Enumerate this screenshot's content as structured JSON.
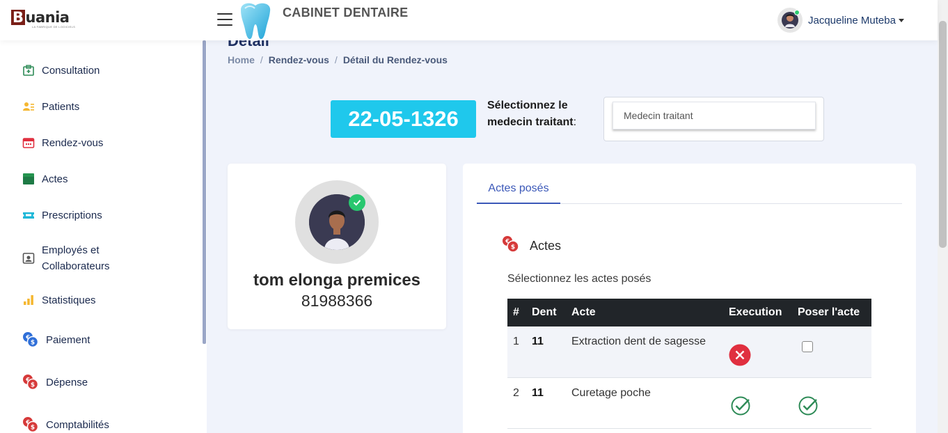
{
  "header": {
    "logo_text": "uania",
    "logo_initial": "B",
    "logo_tagline": "LA FABRIQUE DE LOGICIELS",
    "brand_title": "CABINET DENTAIRE",
    "user_name": "Jacqueline Muteba"
  },
  "sidebar": {
    "items": [
      {
        "label": "Consultation",
        "icon": "stethoscope-icon"
      },
      {
        "label": "Patients",
        "icon": "users-icon"
      },
      {
        "label": "Rendez-vous",
        "icon": "calendar-icon"
      },
      {
        "label": "Actes",
        "icon": "box-icon"
      },
      {
        "label": "Prescriptions",
        "icon": "ticket-icon"
      },
      {
        "label_line1": "Employés et",
        "label_line2": "Collaborateurs",
        "icon": "id-card-icon"
      },
      {
        "label": "Statistiques",
        "icon": "bar-chart-icon"
      },
      {
        "label": "Paiement",
        "icon": "coins-icon"
      },
      {
        "label": "Dépense",
        "icon": "coins-red-icon"
      },
      {
        "label": "Comptabilités",
        "icon": "coins-red-icon"
      }
    ]
  },
  "page": {
    "title": "Détail",
    "breadcrumb": [
      "Home",
      "Rendez-vous",
      "Détail du Rendez-vous"
    ]
  },
  "rdv": {
    "code": "22-05-1326",
    "medecin_label_line1": "Sélectionnez le",
    "medecin_label_line2": "medecin traitant",
    "medecin_label_colon": ":",
    "medecin_placeholder": "Medecin traitant"
  },
  "patient": {
    "name": "tom elonga premices",
    "number": "81988366"
  },
  "actes_card": {
    "tab_label": "Actes posés",
    "section_title": "Actes",
    "subtitle": "Sélectionnez les actes posés",
    "columns": [
      "#",
      "Dent",
      "Acte",
      "Execution",
      "Poser l'acte"
    ],
    "rows": [
      {
        "num": "1",
        "dent": "11",
        "acte": "Extraction dent de sagesse",
        "execution": "not-done",
        "poser": "unchecked"
      },
      {
        "num": "2",
        "dent": "11",
        "acte": "Curetage poche",
        "execution": "done",
        "poser": "done"
      }
    ]
  },
  "colors": {
    "accent": "#1fc8ec",
    "tab_blue": "#3b58b8",
    "success": "#28c76f",
    "danger": "#e02f3f",
    "check_green": "#2e8b57"
  }
}
